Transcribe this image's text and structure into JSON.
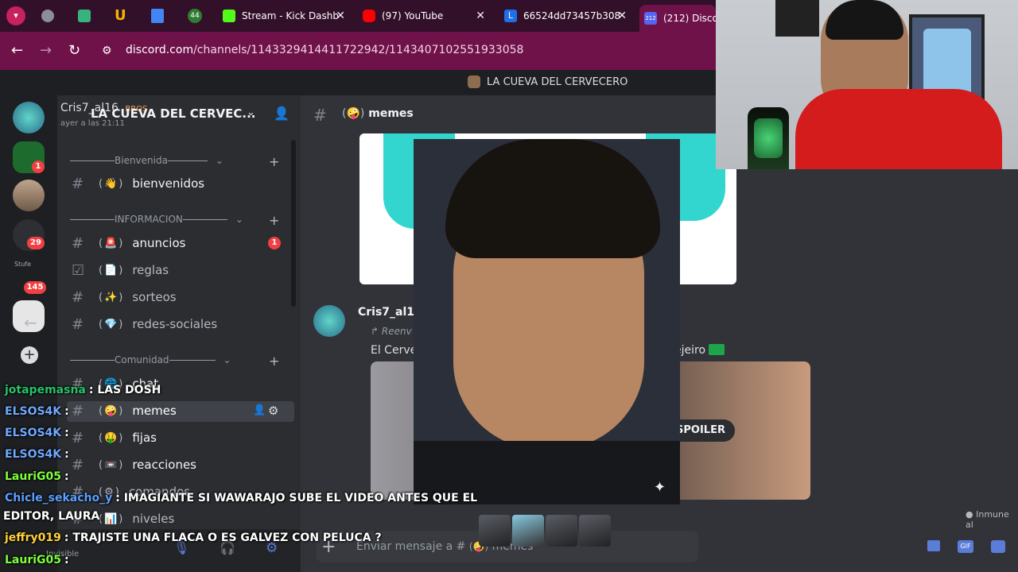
{
  "browser": {
    "tabs": [
      {
        "label": "Stream - Kick Dashb",
        "color": "#53fc18"
      },
      {
        "label": "(97) YouTube",
        "color": "#ff0000"
      },
      {
        "label": "66524dd73457b308",
        "color": "#1e6fe8"
      },
      {
        "label": "(212) Discord",
        "color": "#5865f2"
      }
    ],
    "tab_counter": "44",
    "discord_badge": "212",
    "url_host": "discord.com",
    "url_path": "/channels/1143329414411722942/1143407102551933058"
  },
  "discord": {
    "window_title": "LA CUEVA DEL CERVECERO",
    "server_name": "LA CUEVA DEL CERVEC...",
    "user_overlay": {
      "name": "Cris7_al16",
      "tag": "BROS",
      "time": "ayer a las 21:11"
    },
    "categories": [
      {
        "name": "Bienvenida"
      },
      {
        "name": "INFORMACION"
      },
      {
        "name": "Comunidad"
      }
    ],
    "channels": [
      {
        "name": "bienvenidos",
        "emoji": "👋"
      },
      {
        "name": "anuncios",
        "emoji": "🚨",
        "badge": "1"
      },
      {
        "name": "reglas",
        "emoji": "📄"
      },
      {
        "name": "sorteos",
        "emoji": "✨"
      },
      {
        "name": "redes-sociales",
        "emoji": "💎"
      },
      {
        "name": "chat",
        "emoji": "🌐"
      },
      {
        "name": "memes",
        "emoji": "🤪"
      },
      {
        "name": "fijas",
        "emoji": "🤑"
      },
      {
        "name": "reacciones",
        "emoji": "📼"
      },
      {
        "name": "comandos",
        "emoji": "⚙"
      },
      {
        "name": "niveles",
        "emoji": "📊"
      }
    ],
    "guild_badges": [
      "1",
      "29",
      "145"
    ],
    "current_channel": "memes",
    "message": {
      "author": "Cris7_al16",
      "reply_label": "Reenv",
      "text_start": "El Cerve",
      "text_end": "ejeiro",
      "spoiler_label": "SPOILER"
    },
    "input_placeholder": "Enviar mensaje a #",
    "input_channel": "memes",
    "immune_label": "Inmune al",
    "user_status": "Invisible"
  },
  "stream_chat": [
    {
      "user": "jotapemasna",
      "color": "#27c46a",
      "text": ": LAS DOSH"
    },
    {
      "user": "ELSOS4K",
      "color": "#6fa8ff",
      "text": ":"
    },
    {
      "user": "ELSOS4K",
      "color": "#6fa8ff",
      "text": ":"
    },
    {
      "user": "ELSOS4K",
      "color": "#6fa8ff",
      "text": ":"
    },
    {
      "user": "LauriG05",
      "color": "#7cff3a",
      "text": ":"
    },
    {
      "user": "Chicle_sekacho_y",
      "color": "#5aa0ff",
      "text": ": IMAGIANTE SI WAWARAJO SUBE EL VIDEO ANTES QUE EL"
    },
    {
      "user": "",
      "color": "#ffffff",
      "text": "EDITOR, LAURA"
    },
    {
      "user": "jeffry019",
      "color": "#ffd23a",
      "text": ": TRAJISTE UNA FLACA O ES GALVEZ CON PELUCA ?"
    },
    {
      "user": "LauriG05",
      "color": "#7cff3a",
      "text": ":"
    }
  ]
}
